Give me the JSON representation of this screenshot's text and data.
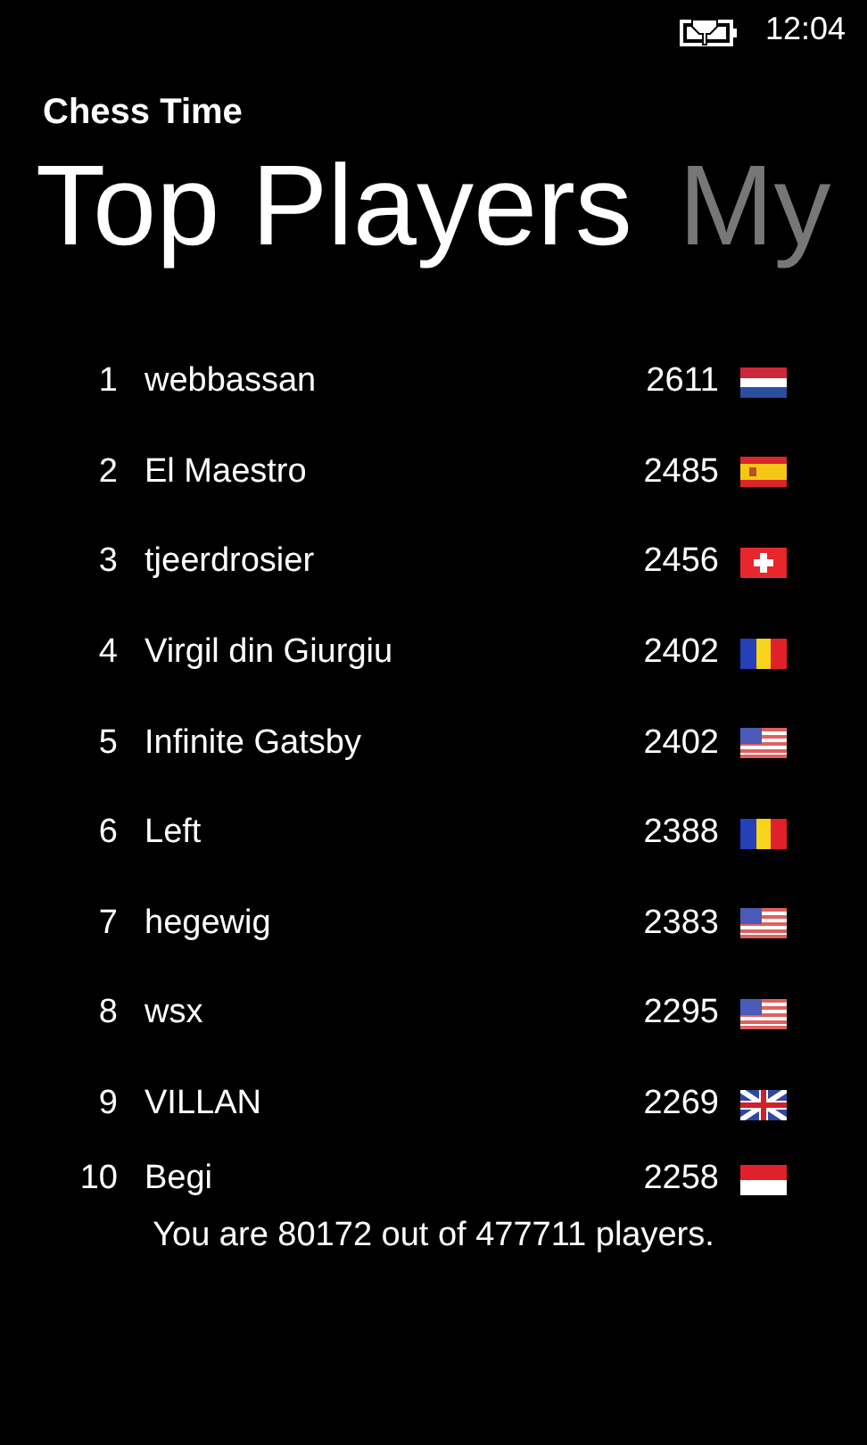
{
  "status_bar": {
    "time": "12:04",
    "charging": true
  },
  "app_title": "Chess Time",
  "pivot": [
    {
      "label": "Top Players",
      "selected": true
    },
    {
      "label": "My",
      "selected": false
    }
  ],
  "players": [
    {
      "rank": "1",
      "name": "webbassan",
      "rating": "2611",
      "kind": "nl"
    },
    {
      "rank": "2",
      "name": "El Maestro",
      "rating": "2485",
      "kind": "es"
    },
    {
      "rank": "3",
      "name": "tjeerdrosier",
      "rating": "2456",
      "kind": "ch"
    },
    {
      "rank": "4",
      "name": "Virgil din Giurgiu",
      "rating": "2402",
      "kind": "ro"
    },
    {
      "rank": "5",
      "name": "Infinite Gatsby",
      "rating": "2402",
      "kind": "us"
    },
    {
      "rank": "6",
      "name": "Left",
      "rating": "2388",
      "kind": "ro"
    },
    {
      "rank": "7",
      "name": "hegewig",
      "rating": "2383",
      "kind": "us"
    },
    {
      "rank": "8",
      "name": "wsx",
      "rating": "2295",
      "kind": "us"
    },
    {
      "rank": "9",
      "name": "VILLAN",
      "rating": "2269",
      "kind": "gb"
    },
    {
      "rank": "10",
      "name": "Begi",
      "rating": "2258",
      "kind": "id"
    }
  ],
  "footer": "You are 80172 out of 477711 players."
}
